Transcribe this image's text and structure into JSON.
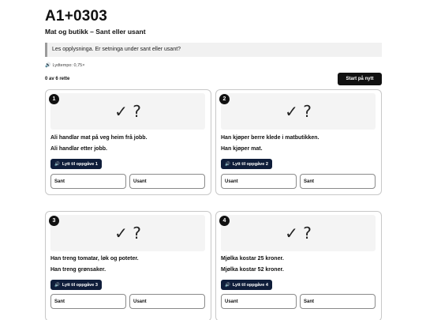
{
  "header": {
    "title": "A1+0303",
    "subtitle": "Mat og butikk – Sant eller usant",
    "instruction": "Les opplysninga. Er setninga under sant eller usant?",
    "tempo": "Lydtempo: 0,75×",
    "score": "0 av 6 rette",
    "restart_label": "Start på nytt"
  },
  "icons": {
    "speaker": "speaker-icon",
    "checkmark": "check-icon",
    "question": "question-mark"
  },
  "colors": {
    "listen_button": "#0f1d3a",
    "restart_button": "#111111",
    "badge": "#111111"
  },
  "tasks": [
    {
      "number": "1",
      "glyph": "✓ ?",
      "statement": "Ali handlar mat på veg heim frå jobb.",
      "claim": "Ali handlar etter jobb.",
      "listen_label": "Lytt til oppgåve 1",
      "true_label": "Sant",
      "false_label": "Usant"
    },
    {
      "number": "2",
      "glyph": "✓ ?",
      "statement": "Han kjøper berre klede i matbutikken.",
      "claim": "Han kjøper mat.",
      "listen_label": "Lytt til oppgåve 2",
      "true_label": "Usant",
      "false_label": "Sant"
    },
    {
      "number": "3",
      "glyph": "✓ ?",
      "statement": "Han treng tomatar, løk og poteter.",
      "claim": "Han treng grønsaker.",
      "listen_label": "Lytt til oppgåve 3",
      "true_label": "Sant",
      "false_label": "Usant"
    },
    {
      "number": "4",
      "glyph": "✓ ?",
      "statement": "Mjølka kostar 25 kroner.",
      "claim": "Mjølka kostar 52 kroner.",
      "listen_label": "Lytt til oppgåve 4",
      "true_label": "Usant",
      "false_label": "Sant"
    }
  ]
}
